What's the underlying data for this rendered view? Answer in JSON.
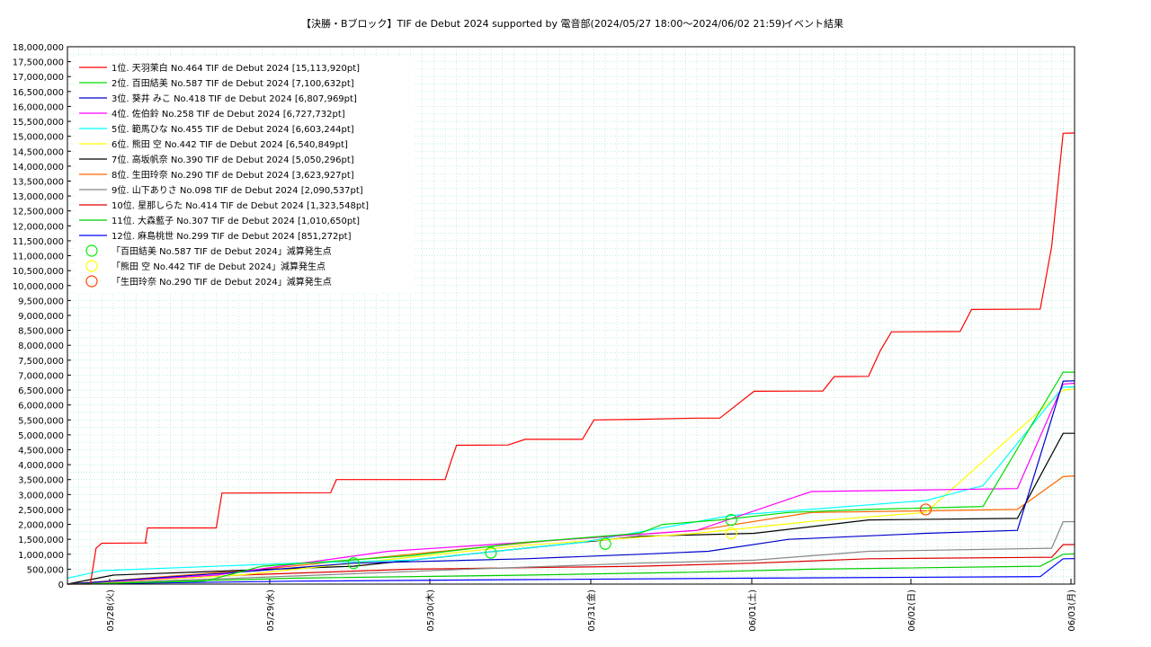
{
  "chart_data": {
    "type": "line",
    "title": "【決勝・Bブロック】TIF de Debut 2024 supported by 電音部(2024/05/27 18:00〜2024/06/02 21:59)",
    "subtitle": "イベント結果",
    "xlabel": "",
    "ylabel": "",
    "x_ticks": [
      "05/28(火)",
      "05/29(水)",
      "05/30(木)",
      "05/31(金)",
      "06/01(土)",
      "06/02(日)",
      "06/03(月)"
    ],
    "xlim": [
      -1,
      6.3
    ],
    "ylim": [
      0,
      18000000
    ],
    "y_step": 500000,
    "grid": true,
    "legend_position": "top-left",
    "series": [
      {
        "name": "1位. 天羽茉白 No.464 TIF de Debut 2024 [15,113,920pt]",
        "color": "#ff0000",
        "points": [
          [
            -1,
            0
          ],
          [
            -0.8,
            0
          ],
          [
            -0.75,
            1200000
          ],
          [
            -0.7,
            1370000
          ],
          [
            -0.3,
            1380000
          ],
          [
            -0.32,
            1380000
          ],
          [
            -0.3,
            1880000
          ],
          [
            0.3,
            1880000
          ],
          [
            0.35,
            3050000
          ],
          [
            1.3,
            3060000
          ],
          [
            1.35,
            3500000
          ],
          [
            2.3,
            3500000
          ],
          [
            2.35,
            4100000
          ],
          [
            2.4,
            4650000
          ],
          [
            2.85,
            4660000
          ],
          [
            3,
            4850000
          ],
          [
            3.5,
            4850000
          ],
          [
            3.6,
            5500000
          ],
          [
            4,
            5520000
          ],
          [
            4.5,
            5560000
          ],
          [
            4.7,
            5560000
          ],
          [
            5.0,
            6460000
          ],
          [
            5.6,
            6470000
          ],
          [
            5.7,
            6950000
          ],
          [
            6.0,
            6960000
          ],
          [
            6.1,
            7800000
          ],
          [
            6.2,
            8450000
          ],
          [
            6.8,
            8460000
          ],
          [
            6.9,
            9200000
          ],
          [
            7.5,
            9210000
          ],
          [
            7.6,
            11300000
          ],
          [
            7.7,
            15100000
          ],
          [
            7.8,
            15110000
          ]
        ]
      },
      {
        "name": "2位. 百田結美 No.587 TIF de Debut 2024 [7,100,632pt]",
        "color": "#00dd00",
        "points": [
          [
            -1,
            0
          ],
          [
            0.2,
            100000
          ],
          [
            0.7,
            600000
          ],
          [
            2,
            950000
          ],
          [
            3,
            1400000
          ],
          [
            4,
            1700000
          ],
          [
            4.2,
            2000000
          ],
          [
            4.7,
            2150000
          ],
          [
            5.3,
            2400000
          ],
          [
            6,
            2500000
          ],
          [
            7,
            2600000
          ],
          [
            7.7,
            7100000
          ],
          [
            7.8,
            7100632
          ]
        ]
      },
      {
        "name": "3位. 葵井 みこ No.418 TIF de Debut 2024 [6,807,969pt]",
        "color": "#0000cc",
        "points": [
          [
            -1,
            0
          ],
          [
            0.5,
            400000
          ],
          [
            1.5,
            700000
          ],
          [
            3,
            850000
          ],
          [
            4,
            1000000
          ],
          [
            4.6,
            1100000
          ],
          [
            5.3,
            1500000
          ],
          [
            6.5,
            1700000
          ],
          [
            7.3,
            1800000
          ],
          [
            7.7,
            6800000
          ],
          [
            7.8,
            6807969
          ]
        ]
      },
      {
        "name": "4位. 佐伯鈴 No.258 TIF de Debut 2024 [6,727,732pt]",
        "color": "#ff00ff",
        "points": [
          [
            -1,
            0
          ],
          [
            0.3,
            300000
          ],
          [
            1.8,
            1100000
          ],
          [
            3,
            1400000
          ],
          [
            4.5,
            1800000
          ],
          [
            5.5,
            3100000
          ],
          [
            7.3,
            3200000
          ],
          [
            7.7,
            6700000
          ],
          [
            7.8,
            6727732
          ]
        ]
      },
      {
        "name": "5位. 範馬ひな No.455 TIF de Debut 2024 [6,603,244pt]",
        "color": "#00ffff",
        "points": [
          [
            -1,
            200000
          ],
          [
            -0.7,
            450000
          ],
          [
            1,
            700000
          ],
          [
            2,
            800000
          ],
          [
            3.5,
            1400000
          ],
          [
            4.8,
            2300000
          ],
          [
            6.5,
            2800000
          ],
          [
            7.0,
            3300000
          ],
          [
            7.7,
            6600000
          ],
          [
            7.8,
            6603244
          ]
        ]
      },
      {
        "name": "6位. 熊田 空 No.442 TIF de Debut 2024 [6,540,849pt]",
        "color": "#ffff00",
        "points": [
          [
            -1,
            0
          ],
          [
            0.5,
            300000
          ],
          [
            2,
            900000
          ],
          [
            3,
            1300000
          ],
          [
            4.5,
            1700000
          ],
          [
            5.5,
            2100000
          ],
          [
            6.5,
            2400000
          ],
          [
            7.7,
            6500000
          ],
          [
            7.8,
            6540849
          ]
        ]
      },
      {
        "name": "7位. 高坂帆奈 No.390 TIF de Debut 2024 [5,050,296pt]",
        "color": "#000000",
        "points": [
          [
            -1,
            0
          ],
          [
            -0.6,
            300000
          ],
          [
            1.5,
            600000
          ],
          [
            3,
            1200000
          ],
          [
            4,
            1600000
          ],
          [
            5,
            1700000
          ],
          [
            6,
            2150000
          ],
          [
            7.3,
            2200000
          ],
          [
            7.7,
            5050000
          ],
          [
            7.8,
            5050296
          ]
        ]
      },
      {
        "name": "8位. 生田玲奈 No.290 TIF de Debut 2024 [3,623,927pt]",
        "color": "#ff6600",
        "points": [
          [
            -1,
            0
          ],
          [
            0.7,
            500000
          ],
          [
            2,
            1000000
          ],
          [
            3.2,
            1450000
          ],
          [
            4.5,
            1800000
          ],
          [
            5.5,
            2400000
          ],
          [
            7.3,
            2500000
          ],
          [
            7.7,
            3600000
          ],
          [
            7.8,
            3623927
          ]
        ]
      },
      {
        "name": "9位. 山下ありさ No.098 TIF de Debut 2024 [2,090,537pt]",
        "color": "#888888",
        "points": [
          [
            -1,
            0
          ],
          [
            0.5,
            200000
          ],
          [
            2.5,
            500000
          ],
          [
            4,
            700000
          ],
          [
            5,
            800000
          ],
          [
            6,
            1100000
          ],
          [
            7.6,
            1200000
          ],
          [
            7.7,
            2090000
          ],
          [
            7.8,
            2090537
          ]
        ]
      },
      {
        "name": "10位. 星那しらた No.414 TIF de Debut 2024 [1,323,548pt]",
        "color": "#dd0000",
        "points": [
          [
            -1,
            0
          ],
          [
            0.5,
            300000
          ],
          [
            2,
            500000
          ],
          [
            4,
            600000
          ],
          [
            5,
            700000
          ],
          [
            6,
            850000
          ],
          [
            7.6,
            900000
          ],
          [
            7.7,
            1320000
          ],
          [
            7.8,
            1323548
          ]
        ]
      },
      {
        "name": "11位. 大森藍子 No.307 TIF de Debut 2024 [1,010,650pt]",
        "color": "#00cc00",
        "points": [
          [
            -1,
            0
          ],
          [
            1,
            200000
          ],
          [
            3,
            300000
          ],
          [
            4.5,
            400000
          ],
          [
            5.5,
            500000
          ],
          [
            7.5,
            600000
          ],
          [
            7.7,
            1000000
          ],
          [
            7.8,
            1010650
          ]
        ]
      },
      {
        "name": "12位. 麻島桃世 No.299 TIF de Debut 2024 [851,272pt]",
        "color": "#0000ff",
        "points": [
          [
            -1,
            0
          ],
          [
            1,
            100000
          ],
          [
            3,
            150000
          ],
          [
            5,
            200000
          ],
          [
            7.5,
            250000
          ],
          [
            7.7,
            850000
          ],
          [
            7.8,
            851272
          ]
        ]
      }
    ],
    "markers": [
      {
        "name": "「百田結美 No.587 TIF de Debut 2024」減算発生点",
        "color": "#00ee00",
        "points": [
          [
            1.5,
            700000
          ],
          [
            2.7,
            1050000
          ],
          [
            3.7,
            1350000
          ],
          [
            4.8,
            2150000
          ]
        ]
      },
      {
        "name": "「熊田 空 No.442 TIF de Debut 2024」減算発生点",
        "color": "#ffff00",
        "points": [
          [
            4.8,
            1700000
          ]
        ]
      },
      {
        "name": "「生田玲奈 No.290 TIF de Debut 2024」減算発生点",
        "color": "#ff4400",
        "points": [
          [
            6.5,
            2500000
          ]
        ]
      }
    ]
  }
}
